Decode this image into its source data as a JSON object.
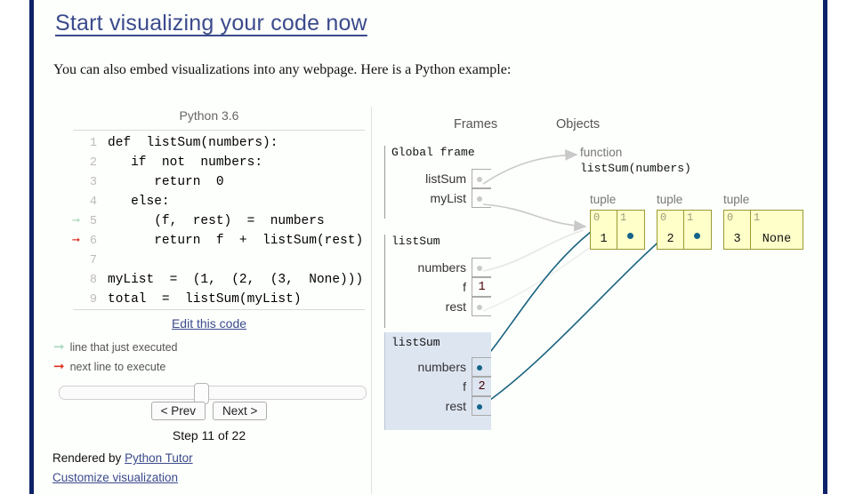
{
  "page": {
    "title": "Start visualizing your code now",
    "intro": "You can also embed visualizations into any webpage. Here is a Python example:"
  },
  "colors": {
    "accent_navy": "#0d2268",
    "link": "#3b4a8c",
    "tuple_fill": "#ffffc9",
    "tuple_border": "#9a9a33",
    "highlight_frame": "#dde5f1",
    "active_arrow": "#14638a",
    "inactive_arrow": "#c9c9c9",
    "exec_arrow_green": "#a8d8bf",
    "next_arrow_red": "#e03222"
  },
  "code_panel": {
    "language_label": "Python 3.6",
    "lines": [
      {
        "n": "1",
        "text": "def  listSum(numbers):",
        "marker": ""
      },
      {
        "n": "2",
        "text": "   if  not  numbers:",
        "marker": ""
      },
      {
        "n": "3",
        "text": "      return  0",
        "marker": ""
      },
      {
        "n": "4",
        "text": "   else:",
        "marker": ""
      },
      {
        "n": "5",
        "text": "      (f,  rest)  =  numbers",
        "marker": "just-executed"
      },
      {
        "n": "6",
        "text": "      return  f  +  listSum(rest)",
        "marker": "next-to-execute"
      },
      {
        "n": "7",
        "text": "",
        "marker": ""
      },
      {
        "n": "8",
        "text": "myList  =  (1,  (2,  (3,  None)))",
        "marker": ""
      },
      {
        "n": "9",
        "text": "total  =  listSum(myList)",
        "marker": ""
      }
    ],
    "edit_link": "Edit this code",
    "legend_executed": "line that just executed",
    "legend_next": "next line to execute",
    "prev_button": "< Prev",
    "next_button": "Next >",
    "step_label": "Step 11 of 22",
    "rendered_prefix": "Rendered by ",
    "rendered_link": "Python Tutor",
    "customize_link": "Customize visualization",
    "slider_position_percent": 45
  },
  "viz_panel": {
    "frames_header": "Frames",
    "objects_header": "Objects",
    "frames": [
      {
        "name": "Global frame",
        "highlighted": false,
        "vars": [
          {
            "label": "listSum",
            "kind": "ref",
            "active": false
          },
          {
            "label": "myList",
            "kind": "ref",
            "active": false
          }
        ]
      },
      {
        "name": "listSum",
        "highlighted": false,
        "vars": [
          {
            "label": "numbers",
            "kind": "ref",
            "active": false
          },
          {
            "label": "f",
            "kind": "value",
            "value": "1"
          },
          {
            "label": "rest",
            "kind": "ref",
            "active": false
          }
        ]
      },
      {
        "name": "listSum",
        "highlighted": true,
        "vars": [
          {
            "label": "numbers",
            "kind": "ref",
            "active": true
          },
          {
            "label": "f",
            "kind": "value",
            "value": "2"
          },
          {
            "label": "rest",
            "kind": "ref",
            "active": true
          }
        ]
      }
    ],
    "objects": {
      "function": {
        "type_label": "function",
        "signature": "listSum(numbers)"
      },
      "tuples": [
        {
          "type_label": "tuple",
          "cells": [
            {
              "index": "0",
              "value": "1",
              "is_pointer": false
            },
            {
              "index": "1",
              "value": "",
              "is_pointer": true
            }
          ]
        },
        {
          "type_label": "tuple",
          "cells": [
            {
              "index": "0",
              "value": "2",
              "is_pointer": false
            },
            {
              "index": "1",
              "value": "",
              "is_pointer": true
            }
          ]
        },
        {
          "type_label": "tuple",
          "cells": [
            {
              "index": "0",
              "value": "3",
              "is_pointer": false
            },
            {
              "index": "1",
              "value": "None",
              "is_pointer": false
            }
          ]
        }
      ]
    }
  }
}
